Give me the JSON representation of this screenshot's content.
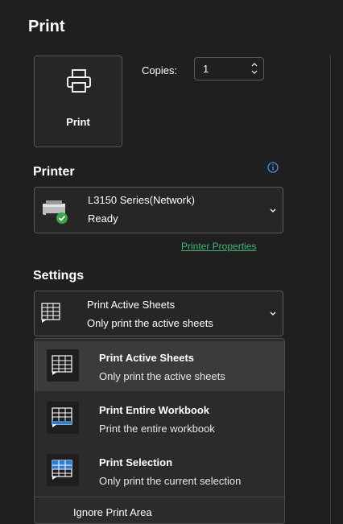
{
  "title": "Print",
  "print_button": {
    "label": "Print",
    "icon": "printer-icon"
  },
  "copies": {
    "label": "Copies:",
    "value": "1"
  },
  "printer": {
    "heading": "Printer",
    "name": "L3150 Series(Network)",
    "status": "Ready",
    "properties_link": "Printer Properties"
  },
  "settings": {
    "heading": "Settings",
    "selected": {
      "title": "Print Active Sheets",
      "desc": "Only print the active sheets"
    },
    "options": [
      {
        "title": "Print Active Sheets",
        "desc": "Only print the active sheets",
        "selected": true
      },
      {
        "title": "Print Entire Workbook",
        "desc": "Print the entire workbook",
        "selected": false
      },
      {
        "title": "Print Selection",
        "desc": "Only print the current selection",
        "selected": false
      }
    ],
    "ignore_label": "Ignore Print Area"
  },
  "colors": {
    "background": "#1f1f1f",
    "link": "#3fb47c",
    "accent_blue": "#2d7fd8",
    "status_green": "#3aa34a"
  }
}
